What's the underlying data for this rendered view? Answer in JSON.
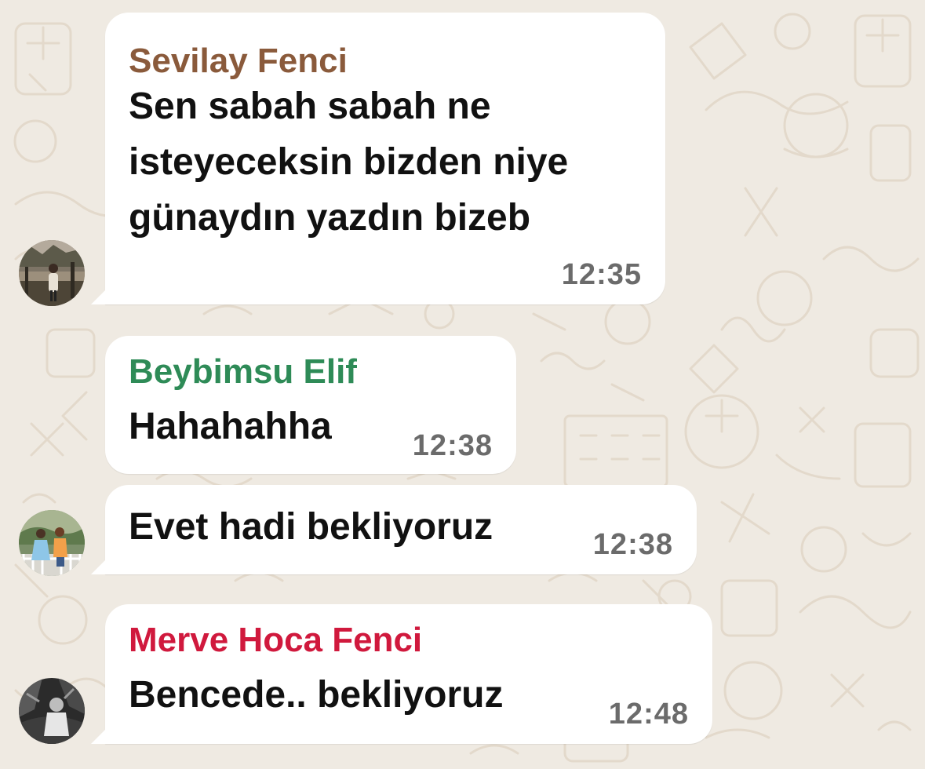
{
  "messages": [
    {
      "sender": "Sevilay Fenci",
      "sender_color": "#8a5a3b",
      "lines": [
        "Sen sabah sabah ne",
        "isteyeceksin bizden niye",
        "günaydın yazdın bizeb"
      ],
      "time": "12:35"
    },
    {
      "sender": "Beybimsu Elif",
      "sender_color": "#2e8b57",
      "lines": [
        "Hahahahha"
      ],
      "time": "12:38"
    },
    {
      "sender": "",
      "lines": [
        "Evet hadi bekliyoruz"
      ],
      "time": "12:38"
    },
    {
      "sender": "Merve Hoca Fenci",
      "sender_color": "#d0193d",
      "lines": [
        "Bencede.. bekliyoruz"
      ],
      "time": "12:48"
    }
  ],
  "colors": {
    "wallpaper": "#efeae2",
    "doodle": "#e3dccf",
    "bubble": "#ffffff",
    "text": "#111111",
    "timestamp": "#6b6b6b"
  },
  "icons": {
    "avatar_1": "profile-photo-icon",
    "avatar_2": "profile-photo-icon",
    "avatar_3": "profile-photo-icon"
  }
}
